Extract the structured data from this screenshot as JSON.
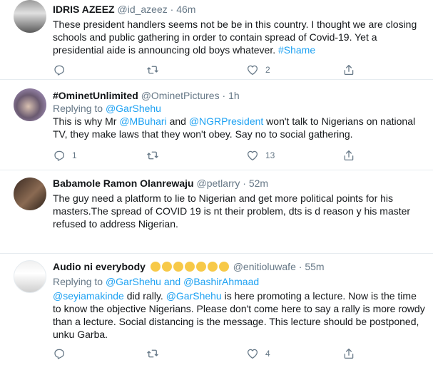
{
  "tweets": [
    {
      "name": "IDRIS AZEEZ",
      "handle": "@id_azeez",
      "time": "46m",
      "reply_prefix": "",
      "reply_to": "",
      "text_before": "These president handlers seems not be be in this country. I thought we are closing schools and public gathering in order to contain spread of Covid-19. Yet a presidential aide is announcing old boys whatever. ",
      "hashtag": "#Shame",
      "replies": "",
      "retweets": "",
      "likes": "2"
    },
    {
      "name": "#OminetUnlimited",
      "handle": "@OminetPictures",
      "time": "1h",
      "reply_prefix": "Replying to ",
      "reply_to": "@GarShehu",
      "text_1": "This is why Mr ",
      "mention_1": "@MBuhari",
      "text_2": " and ",
      "mention_2": "@NGRPresident",
      "text_3": " won't talk to Nigerians on national TV, they make laws that they won't obey. Say no to social gathering.",
      "replies": "1",
      "retweets": "",
      "likes": "13"
    },
    {
      "name": "Babamole Ramon Olanrewaju",
      "handle": "@petlarry",
      "time": "52m",
      "text": "The guy need a platform to lie to Nigerian and get more political points for his masters.The spread of COVID 19 is nt their problem, dts is d reason y his master refused to address Nigerian."
    },
    {
      "name": "Audio ni everybody",
      "handle": "@enitioluwafe",
      "time": "55m",
      "reply_prefix": "Replying to ",
      "reply_to": "@GarShehu and @BashirAhmaad",
      "mention_1": "@seyiamakinde",
      "text_1": " did rally. ",
      "mention_2": "@GarShehu",
      "text_2": " is here promoting a lecture. Now is the time to know the objective Nigerians. Please don't come here to say a rally is more rowdy than a lecture. Social distancing is the message. This lecture should be postponed, unku Garba.",
      "replies": "",
      "retweets": "",
      "likes": "4"
    }
  ],
  "separator": "·",
  "colors": {
    "link": "#1da1f2",
    "muted": "#657786",
    "border": "#e6ecf0"
  },
  "icons": [
    "reply-icon",
    "retweet-icon",
    "like-icon",
    "share-icon"
  ]
}
